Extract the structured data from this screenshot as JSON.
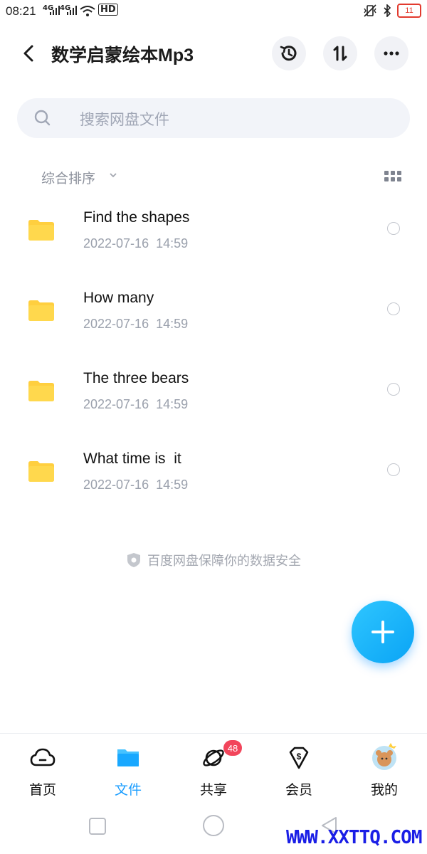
{
  "status_bar": {
    "time": "08:21",
    "signal1": "4G",
    "signal2": "4G",
    "hd": "HD",
    "battery": "11",
    "battery_color": "#e23a2e"
  },
  "header": {
    "title": "数学启蒙绘本Mp3",
    "icons": [
      "back-icon",
      "history-icon",
      "transfer-icon",
      "more-icon"
    ]
  },
  "search": {
    "placeholder": "搜索网盘文件"
  },
  "sort": {
    "label": "综合排序"
  },
  "files": [
    {
      "name": "Find the shapes",
      "date": "2022-07-16  14:59"
    },
    {
      "name": "How many",
      "date": "2022-07-16  14:59"
    },
    {
      "name": "The three bears",
      "date": "2022-07-16  14:59"
    },
    {
      "name": "What time is  it",
      "date": "2022-07-16  14:59"
    }
  ],
  "secure_note": "百度网盘保障你的数据安全",
  "tabs": [
    {
      "label": "首页",
      "icon": "cloud-icon"
    },
    {
      "label": "文件",
      "icon": "folder-icon",
      "active": true
    },
    {
      "label": "共享",
      "icon": "share-icon",
      "badge": "48"
    },
    {
      "label": "会员",
      "icon": "vip-icon"
    },
    {
      "label": "我的",
      "icon": "avatar-icon"
    }
  ],
  "watermark": "WWW.XXTTQ.COM",
  "colors": {
    "accent": "#1a9dff",
    "folder": "#ffcf3f",
    "badge": "#f2455b"
  }
}
